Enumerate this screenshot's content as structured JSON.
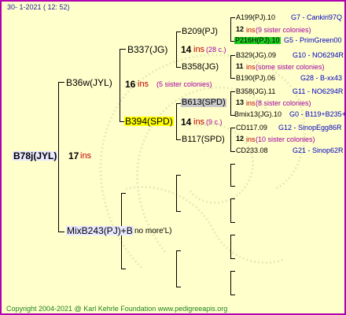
{
  "header": "30-   1-2021  ( 12:  52)",
  "footer": "Copyright 2004-2021 @ Karl Kehrle Foundation    www.pedigreeapis.org",
  "root": {
    "name": "B78j(JYL)",
    "num": "17",
    "ins": "ins"
  },
  "sire": {
    "name": "B36w(JYL)",
    "num": "16",
    "ins": "ins",
    "sis": "(5 sister colonies)"
  },
  "dam": {
    "name": "MixB243(PJ)+B",
    "note": "no more'L)"
  },
  "g2": {
    "a": {
      "name": "B337(JG)",
      "num": "14",
      "ins": "ins",
      "sis": "(28 c.)"
    },
    "b": {
      "name": "B394(SPD)",
      "num": "14",
      "ins": "ins",
      "sis": "(9 c.)"
    }
  },
  "g3": {
    "a": {
      "name": "B209(PJ)"
    },
    "b": {
      "name": "B358(JG)"
    },
    "c": {
      "name": "B613(SPD)"
    },
    "d": {
      "name": "B117(SPD)"
    }
  },
  "g4": [
    {
      "name": "A199(PJ).10",
      "code": "G7 - Cankiri97Q"
    },
    {
      "num": "12",
      "ins": "ins",
      "sis": "(9 sister colonies)"
    },
    {
      "name": "P216H(PJ).10",
      "code": "G5 - PrimGreen00"
    },
    {
      "name": "B329(JG).09",
      "code": "G10 - NO6294R"
    },
    {
      "num": "11",
      "ins": "ins",
      "sis": "(some sister colonies)"
    },
    {
      "name": "B190(PJ).06",
      "code": "G28 - B-xx43"
    },
    {
      "name": "B358(JG).11",
      "code": "G11 - NO6294R"
    },
    {
      "num": "13",
      "ins": "ins",
      "sis": "(8 sister colonies)"
    },
    {
      "name": "Bmix13(JG).10",
      "code": "G0 - B119+B235+B"
    },
    {
      "name": "CD117.09",
      "code": "G12 - SinopEgg86R"
    },
    {
      "num": "12",
      "ins": "ins",
      "sis": "(10 sister colonies)"
    },
    {
      "name": "CD233.08",
      "code": "G21 - Sinop62R"
    }
  ]
}
